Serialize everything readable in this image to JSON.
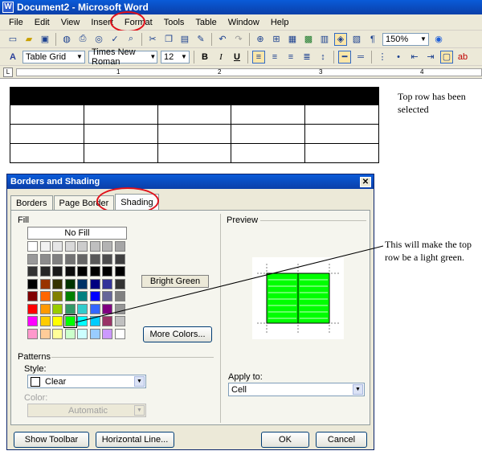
{
  "window": {
    "title": "Document2 - Microsoft Word"
  },
  "menu": [
    "File",
    "Edit",
    "View",
    "Insert",
    "Format",
    "Tools",
    "Table",
    "Window",
    "Help"
  ],
  "toolbar": {
    "zoom": "150%",
    "style": "Table Grid",
    "font": "Times New Roman",
    "size": "12",
    "bold": "B",
    "italic": "I",
    "underline": "U",
    "paragraph": "¶"
  },
  "ruler": {
    "numbers": [
      "1",
      "2",
      "3",
      "4"
    ]
  },
  "notes": {
    "top_row": "Top row has been selected",
    "green": "This will make the top row be a light green."
  },
  "dialog": {
    "title": "Borders and Shading",
    "tabs": [
      "Borders",
      "Page Border",
      "Shading"
    ],
    "fill_label": "Fill",
    "no_fill": "No Fill",
    "color_name": "Bright Green",
    "more_colors": "More Colors...",
    "patterns_label": "Patterns",
    "style_label": "Style:",
    "style_value": "Clear",
    "color_label": "Color:",
    "color_value": "Automatic",
    "preview_label": "Preview",
    "apply_label": "Apply to:",
    "apply_value": "Cell",
    "buttons": {
      "show_toolbar": "Show Toolbar",
      "horizontal_line": "Horizontal Line...",
      "ok": "OK",
      "cancel": "Cancel"
    }
  },
  "palette": [
    [
      "#000000",
      "#993300",
      "#333300",
      "#003300",
      "#003366",
      "#000080",
      "#333399",
      "#333333"
    ],
    [
      "#800000",
      "#ff6600",
      "#808000",
      "#008000",
      "#008080",
      "#0000ff",
      "#666699",
      "#808080"
    ],
    [
      "#ff0000",
      "#ff9900",
      "#99cc00",
      "#339966",
      "#33cccc",
      "#3366ff",
      "#800080",
      "#969696"
    ],
    [
      "#ff00ff",
      "#ffcc00",
      "#ffff00",
      "#00ff00",
      "#00ffff",
      "#00ccff",
      "#993366",
      "#c0c0c0"
    ],
    [
      "#ff99cc",
      "#ffcc99",
      "#ffff99",
      "#ccffcc",
      "#ccffff",
      "#99ccff",
      "#cc99ff",
      "#ffffff"
    ]
  ],
  "gray_rows": [
    [
      "#ffffff",
      "#f2f2f2",
      "#e6e6e6",
      "#d9d9d9",
      "#cccccc",
      "#bfbfbf",
      "#b3b3b3",
      "#a6a6a6"
    ],
    [
      "#999999",
      "#8c8c8c",
      "#808080",
      "#737373",
      "#666666",
      "#595959",
      "#4d4d4d",
      "#404040"
    ],
    [
      "#333333",
      "#262626",
      "#1a1a1a",
      "#0d0d0d",
      "#000000",
      "#000000",
      "#000000",
      "#000000"
    ]
  ],
  "colors": {
    "selected_fill": "#00ff00",
    "highlight": "#e0101a"
  }
}
